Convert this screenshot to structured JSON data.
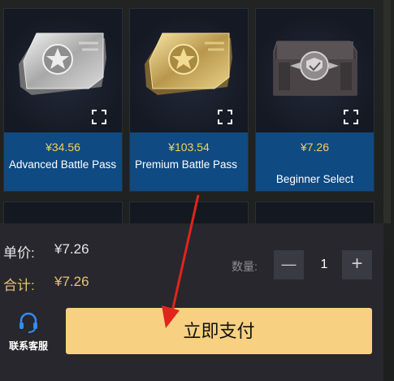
{
  "products": [
    {
      "price": "¥34.56",
      "name": "Advanced Battle Pass"
    },
    {
      "price": "¥103.54",
      "name": "Premium Battle Pass"
    },
    {
      "price": "¥7.26",
      "name": "Beginner Select"
    }
  ],
  "summary": {
    "unit_price_label": "单价:",
    "unit_price_value": "¥7.26",
    "total_label": "合计:",
    "total_value": "¥7.26"
  },
  "quantity": {
    "label": "数量:",
    "minus": "—",
    "value": "1",
    "plus": "+"
  },
  "support": {
    "label": "联系客服"
  },
  "pay_button": {
    "label": "立即支付"
  },
  "colors": {
    "accent_price": "#f1d25c",
    "price_band": "#0f4a82",
    "pay_button": "#f7d081",
    "annotation_arrow": "#e0251b"
  }
}
